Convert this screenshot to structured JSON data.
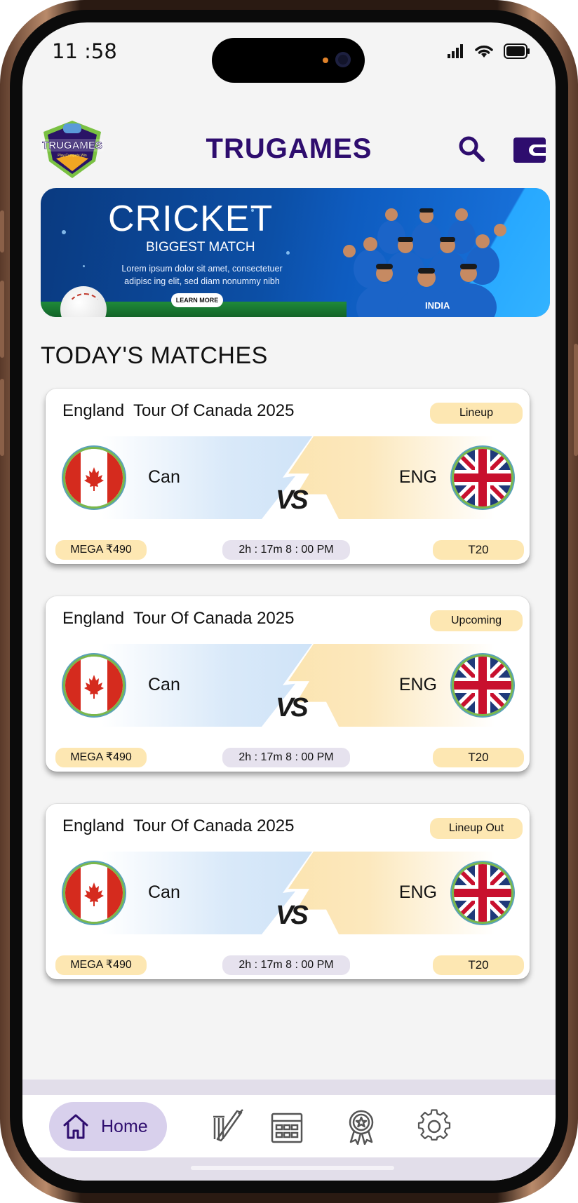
{
  "status_bar": {
    "time": "11 :58"
  },
  "header": {
    "app_title": "TRUGAMES",
    "logo_text": "TRUGAMES",
    "logo_tagline": "Play Compete Win"
  },
  "banner": {
    "title": "CRICKET",
    "subtitle": "BIGGEST MATCH",
    "description": "Lorem ipsum dolor sit amet, consectetuer adipisc ing elit, sed diam nonummy nibh",
    "button_label": "LEARN MORE",
    "caption": "INDIA"
  },
  "section_title": "TODAY'S MATCHES",
  "matches": [
    {
      "title": "England  Tour Of Canada 2025",
      "status": "Lineup",
      "team_left": "Can",
      "team_right": "ENG",
      "vs": "VS",
      "prize": "MEGA  ₹490",
      "time": "2h : 17m  8 : 00 PM",
      "format": "T20"
    },
    {
      "title": "England  Tour Of Canada 2025",
      "status": "Upcoming",
      "team_left": "Can",
      "team_right": "ENG",
      "vs": "VS",
      "prize": "MEGA  ₹490",
      "time": "2h : 17m  8 : 00 PM",
      "format": "T20"
    },
    {
      "title": "England  Tour Of Canada 2025",
      "status": "Lineup Out",
      "team_left": "Can",
      "team_right": "ENG",
      "vs": "VS",
      "prize": "MEGA  ₹490",
      "time": "2h : 17m  8 : 00 PM",
      "format": "T20"
    }
  ],
  "bottom_nav": {
    "home_label": "Home",
    "items": [
      "home-icon",
      "cricket-bat-icon",
      "calendar-icon",
      "award-icon",
      "settings-icon"
    ]
  },
  "colors": {
    "brand": "#2e0d6e",
    "pill_yellow": "#fde7b2",
    "pill_lavender": "#e6e2ee",
    "home_active_bg": "#d8d0ec"
  }
}
